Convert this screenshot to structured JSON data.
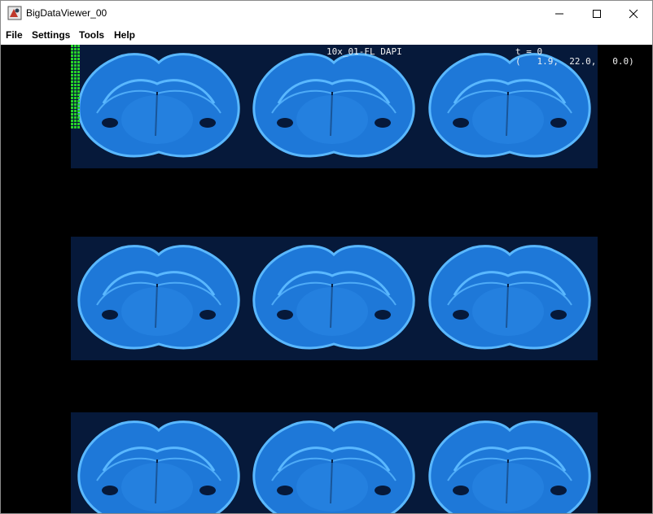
{
  "window": {
    "title": "BigDataViewer_00",
    "controls": [
      "minimize-icon",
      "maximize-icon",
      "close-icon"
    ]
  },
  "menu": {
    "items": [
      "File",
      "Settings",
      "Tools",
      "Help"
    ]
  },
  "viewer": {
    "source_name": "10x_01-FL DAPI",
    "timepoint_text": "t = 0",
    "coordinates_text": "(   1.9,  22.0,   0.0)",
    "colors": {
      "background": "#000000",
      "tissue": "#1e78d8",
      "tissue_highlight": "#5ab8ff",
      "tile_background": "#06193a",
      "minimap": "#28d228"
    },
    "tile_grid": {
      "rows": 3,
      "columns": 3
    }
  }
}
